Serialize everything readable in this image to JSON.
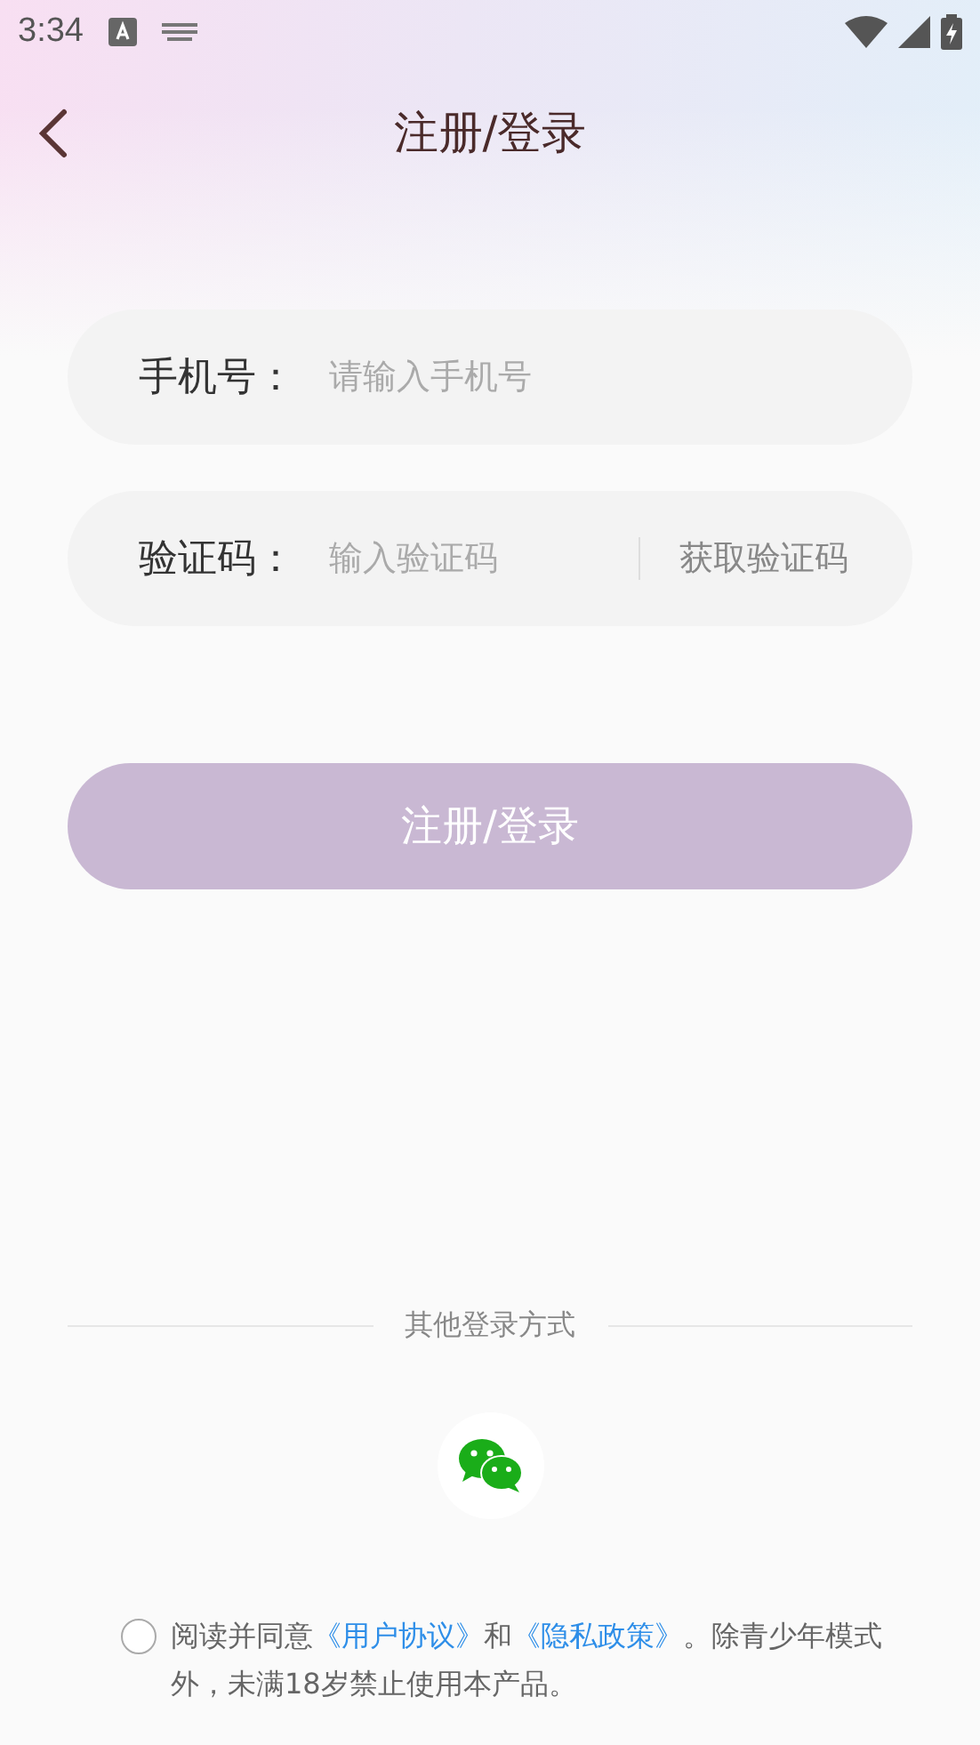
{
  "status_bar": {
    "time": "3:34"
  },
  "header": {
    "title": "注册/登录"
  },
  "fields": [
    {
      "label": "手机号：",
      "placeholder": "请输入手机号"
    },
    {
      "label": "验证码：",
      "placeholder": "输入验证码",
      "action": "获取验证码"
    }
  ],
  "submit": {
    "label": "注册/登录",
    "disabled": true
  },
  "other_login": {
    "label": "其他登录方式"
  },
  "agreement": {
    "checked": false,
    "parts": [
      {
        "kind": "text",
        "text": "阅读并同意"
      },
      {
        "kind": "link",
        "text": "《用户协议》"
      },
      {
        "kind": "text",
        "text": "和"
      },
      {
        "kind": "link",
        "text": "《隐私政策》"
      },
      {
        "kind": "text",
        "text": "。除青少年模式外，未满18岁禁止使用本产品。"
      }
    ]
  }
}
